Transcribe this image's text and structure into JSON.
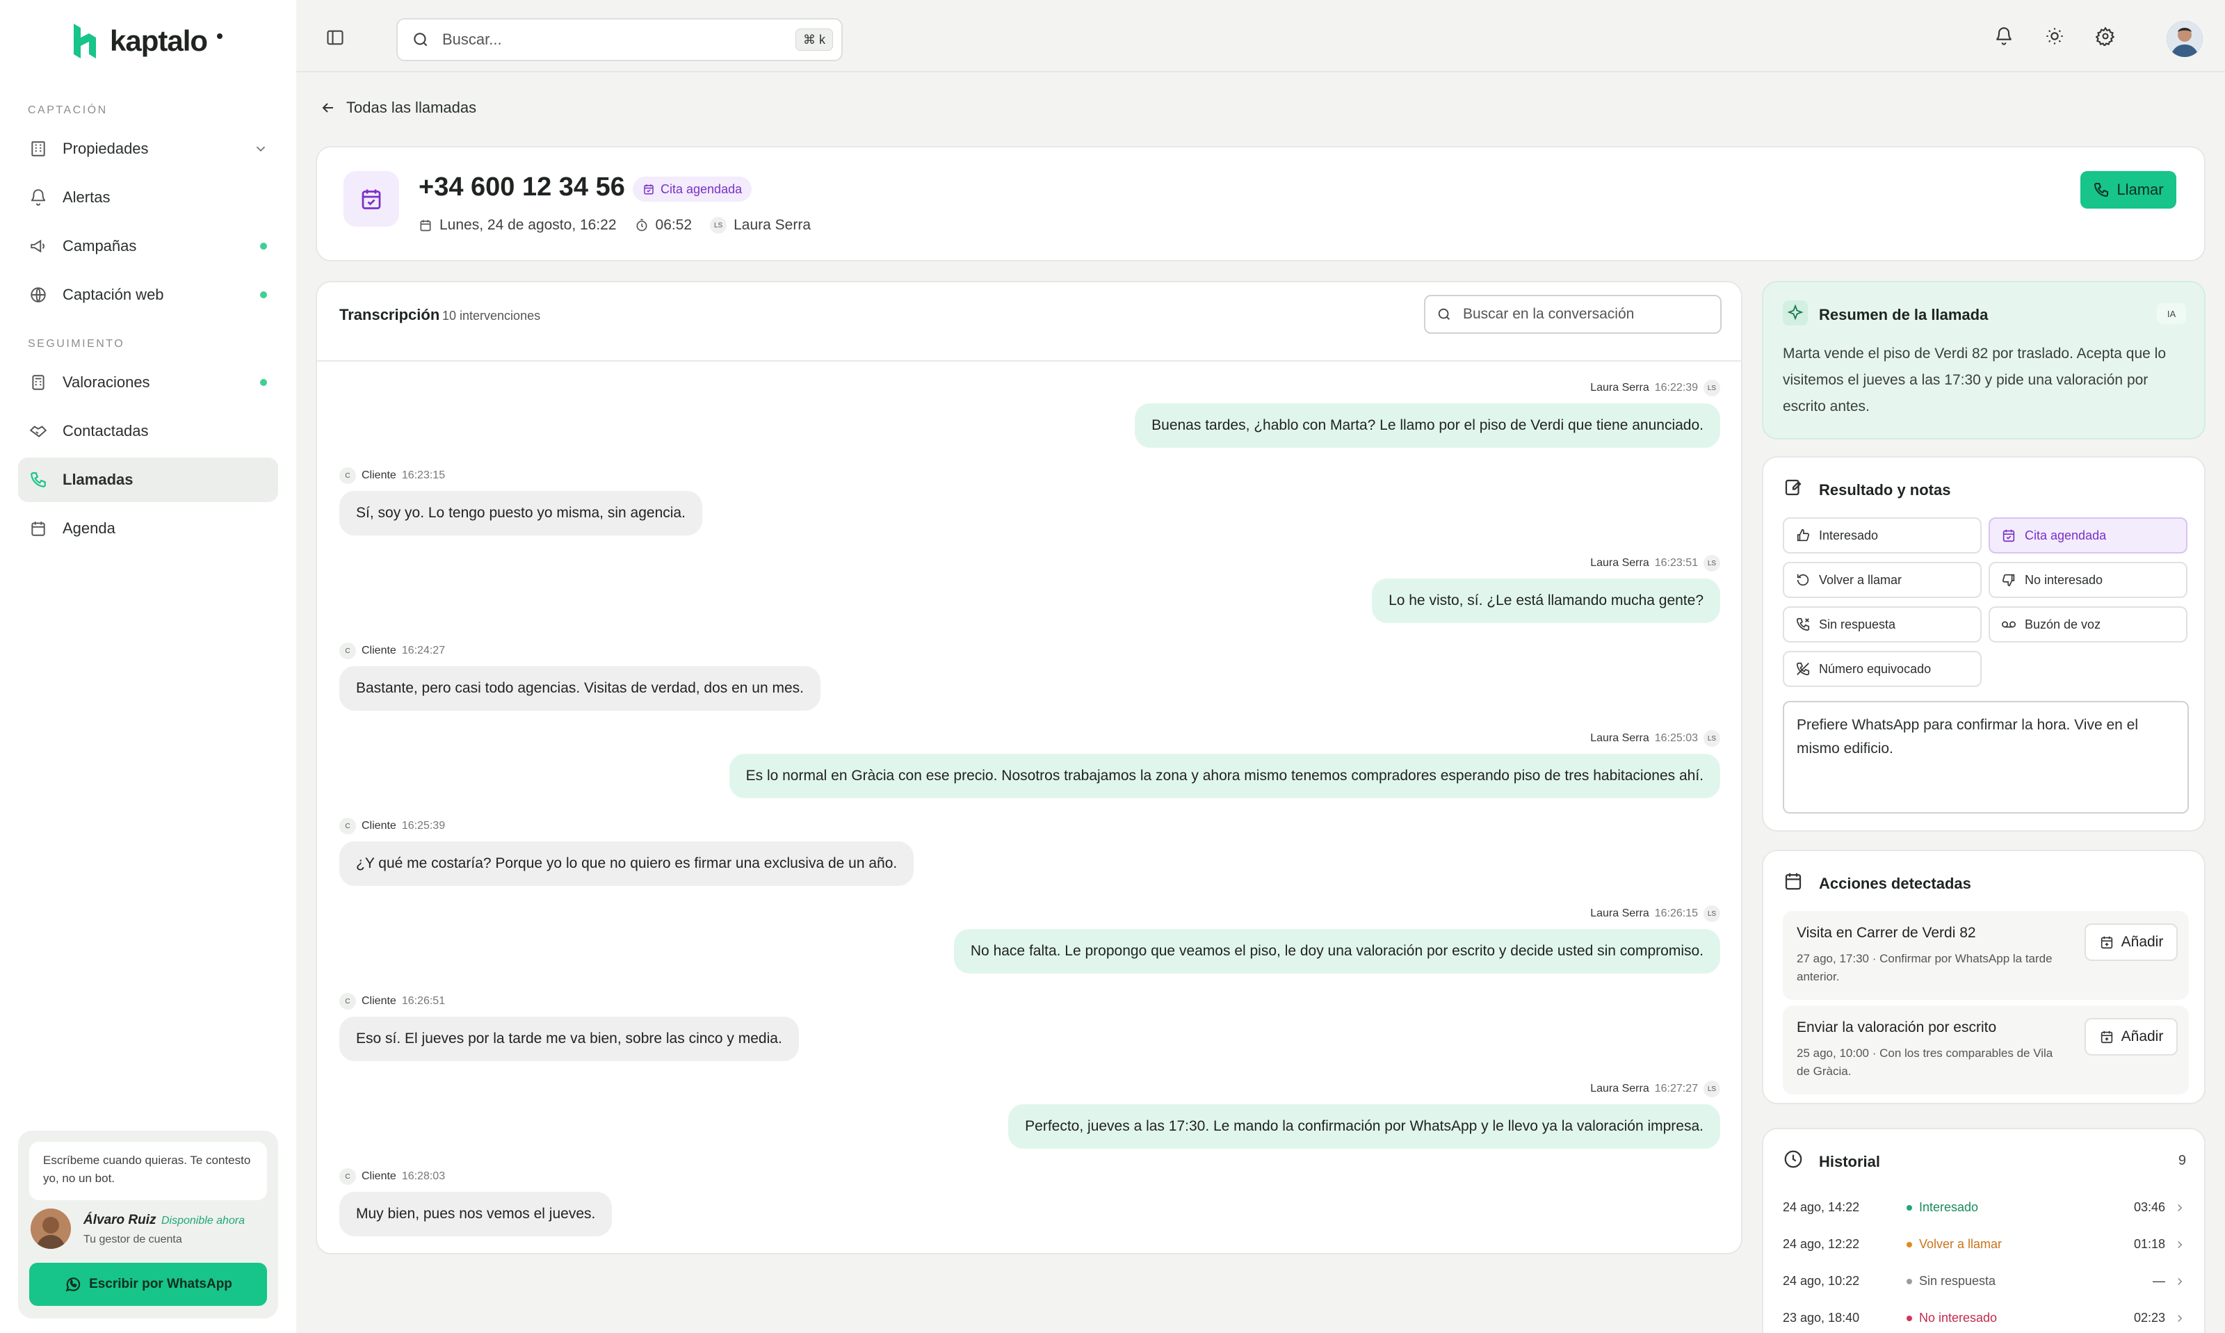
{
  "brand": {
    "name": "kaptalo"
  },
  "sidebar": {
    "section_captacion": "CAPTACIÓN",
    "section_seguimiento": "SEGUIMIENTO",
    "items": [
      {
        "label": "Propiedades",
        "icon": "building-icon"
      },
      {
        "label": "Alertas",
        "icon": "bell-icon"
      },
      {
        "label": "Campañas",
        "icon": "megaphone-icon"
      },
      {
        "label": "Captación web",
        "icon": "globe-icon"
      },
      {
        "label": "Valoraciones",
        "icon": "calculator-icon"
      },
      {
        "label": "Contactadas",
        "icon": "handshake-icon"
      },
      {
        "label": "Llamadas",
        "icon": "phone-icon",
        "active": true
      },
      {
        "label": "Agenda",
        "icon": "calendar-icon"
      }
    ],
    "help": {
      "message": "Escríbeme cuando quieras. Te contesto yo, no un bot.",
      "name": "Álvaro Ruiz",
      "status": "Disponible ahora",
      "role": "Tu gestor de cuenta",
      "button": "Escribir por WhatsApp"
    }
  },
  "topbar": {
    "search_placeholder": "Buscar...",
    "shortcut": "⌘ k"
  },
  "back_link": "Todas las llamadas",
  "call": {
    "phone": "+34 600 12 34 56",
    "status": "Cita agendada",
    "date": "Lunes, 24 de agosto, 16:22",
    "duration": "06:52",
    "agent_initials": "LS",
    "agent": "Laura Serra",
    "call_button": "Llamar"
  },
  "transcript": {
    "title": "Transcripción",
    "count": "10 intervenciones",
    "search_placeholder": "Buscar en la conversación",
    "messages": [
      {
        "speaker": "Laura Serra",
        "time": "16:22:39",
        "initials": "LS",
        "text": "Buenas tardes, ¿hablo con Marta? Le llamo por el piso de Verdi que tiene anunciado."
      },
      {
        "speaker": "Cliente",
        "time": "16:23:15",
        "initials": "C",
        "text": "Sí, soy yo. Lo tengo puesto yo misma, sin agencia."
      },
      {
        "speaker": "Laura Serra",
        "time": "16:23:51",
        "initials": "LS",
        "text": "Lo he visto, sí. ¿Le está llamando mucha gente?"
      },
      {
        "speaker": "Cliente",
        "time": "16:24:27",
        "initials": "C",
        "text": "Bastante, pero casi todo agencias. Visitas de verdad, dos en un mes."
      },
      {
        "speaker": "Laura Serra",
        "time": "16:25:03",
        "initials": "LS",
        "text": "Es lo normal en Gràcia con ese precio. Nosotros trabajamos la zona y ahora mismo tenemos compradores esperando piso de tres habitaciones ahí."
      },
      {
        "speaker": "Cliente",
        "time": "16:25:39",
        "initials": "C",
        "text": "¿Y qué me costaría? Porque yo lo que no quiero es firmar una exclusiva de un año."
      },
      {
        "speaker": "Laura Serra",
        "time": "16:26:15",
        "initials": "LS",
        "text": "No hace falta. Le propongo que veamos el piso, le doy una valoración por escrito y decide usted sin compromiso."
      },
      {
        "speaker": "Cliente",
        "time": "16:26:51",
        "initials": "C",
        "text": "Eso sí. El jueves por la tarde me va bien, sobre las cinco y media."
      },
      {
        "speaker": "Laura Serra",
        "time": "16:27:27",
        "initials": "LS",
        "text": "Perfecto, jueves a las 17:30. Le mando la confirmación por WhatsApp y le llevo ya la valoración impresa."
      },
      {
        "speaker": "Cliente",
        "time": "16:28:03",
        "initials": "C",
        "text": "Muy bien, pues nos vemos el jueves."
      }
    ]
  },
  "summary": {
    "title": "Resumen de la llamada",
    "badge": "IA",
    "text": "Marta vende el piso de Verdi 82 por traslado. Acepta que lo visitemos el jueves a las 17:30 y pide una valoración por escrito antes."
  },
  "result": {
    "title": "Resultado y notas",
    "options": [
      {
        "label": "Interesado",
        "icon": "thumbs-up-icon"
      },
      {
        "label": "Cita agendada",
        "icon": "calendar-check-icon",
        "selected": true
      },
      {
        "label": "Volver a llamar",
        "icon": "rotate-icon"
      },
      {
        "label": "No interesado",
        "icon": "thumbs-down-icon"
      },
      {
        "label": "Sin respuesta",
        "icon": "phone-missed-icon"
      },
      {
        "label": "Buzón de voz",
        "icon": "voicemail-icon"
      },
      {
        "label": "Número equivocado",
        "icon": "phone-off-icon"
      }
    ],
    "notes": "Prefiere WhatsApp para confirmar la hora. Vive en el mismo edificio."
  },
  "actions": {
    "title": "Acciones detectadas",
    "items": [
      {
        "title": "Visita en Carrer de Verdi 82",
        "desc": "27 ago, 17:30 · Confirmar por WhatsApp la tarde anterior.",
        "button": "Añadir"
      },
      {
        "title": "Enviar la valoración por escrito",
        "desc": "25 ago, 10:00 · Con los tres comparables de Vila de Gràcia.",
        "button": "Añadir"
      }
    ]
  },
  "history": {
    "title": "Historial",
    "count": "9",
    "rows": [
      {
        "date": "24 ago, 14:22",
        "status": "Interesado",
        "color": "#1fa873",
        "duration": "03:46"
      },
      {
        "date": "24 ago, 12:22",
        "status": "Volver a llamar",
        "color": "#e08a1e",
        "duration": "01:18"
      },
      {
        "date": "24 ago, 10:22",
        "status": "Sin respuesta",
        "color": "#9a9e9a",
        "duration": "—"
      },
      {
        "date": "23 ago, 18:40",
        "status": "No interesado",
        "color": "#d6335a",
        "duration": "02:23"
      }
    ]
  },
  "colors": {
    "accent": "#17c489",
    "purple": "#7a30c7"
  }
}
